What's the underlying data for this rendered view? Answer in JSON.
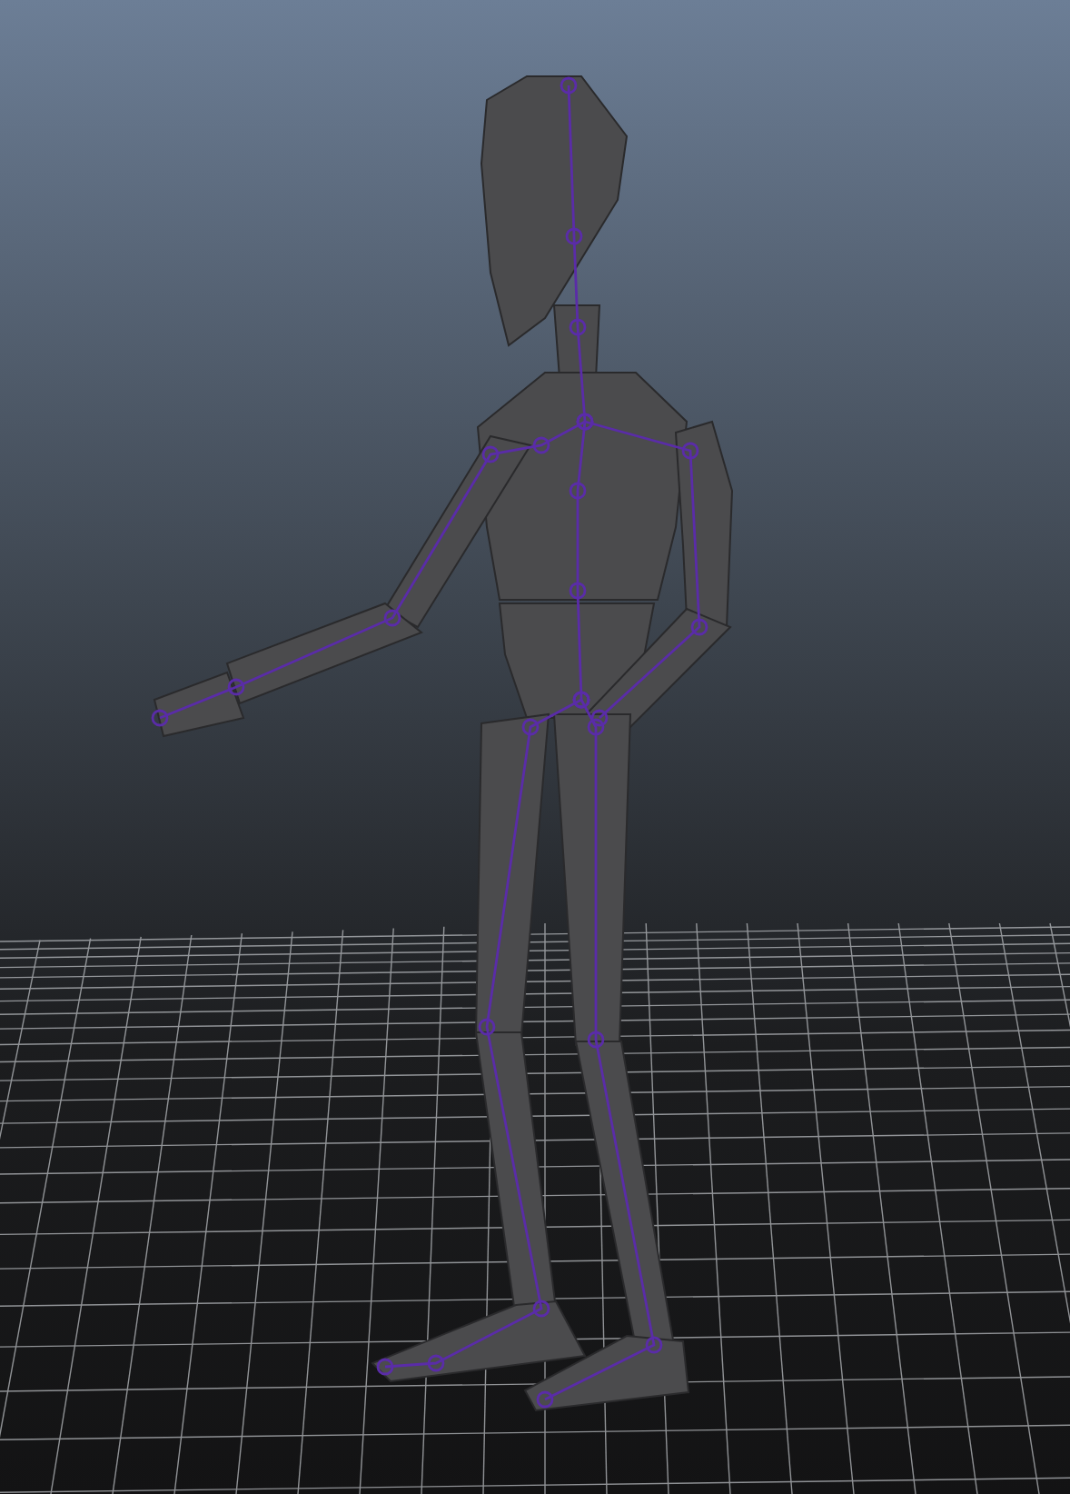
{
  "viewport": {
    "show_grid": true,
    "show_joints": true
  }
}
